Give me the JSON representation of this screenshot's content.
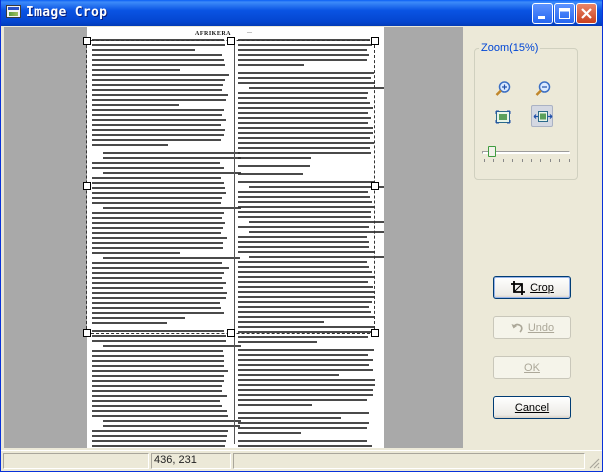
{
  "window": {
    "title": "Image Crop"
  },
  "zoom": {
    "label": "Zoom(15%)",
    "level_percent": 15,
    "slider_fraction": 0.08
  },
  "document": {
    "heading": "AFRIKERA"
  },
  "buttons": {
    "crop": "Crop",
    "undo": "Undo",
    "ok": "OK",
    "cancel": "Cancel"
  },
  "status": {
    "coordinates": "436, 231"
  },
  "icons": {
    "zoom_in": "zoom-in-icon",
    "zoom_out": "zoom-out-icon",
    "fit_image": "fit-image-icon",
    "fit_width": "fit-width-icon",
    "crop": "crop-icon",
    "undo": "undo-icon"
  },
  "colors": {
    "titlebar": "#0a54e3",
    "group_label": "#0046d5",
    "canvas_background": "#a9a9a9",
    "slider_thumb_border": "#3f9c3f"
  }
}
